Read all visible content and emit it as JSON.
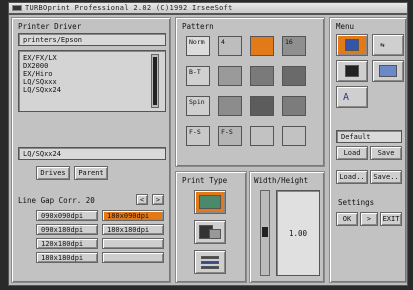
{
  "window": {
    "title": "TURBOprint Professional 2.02 (C)1992 IrseeSoft"
  },
  "printer_driver": {
    "heading": "Printer Driver",
    "path_value": "printers/Epson",
    "list_items": [
      "EX/FX/LX",
      "DX2000",
      "EX/Hiro",
      "LQ/SQxxx",
      "LQ/SQxx24"
    ],
    "selected_value": "LQ/SQxx24",
    "drives_button": "Drives",
    "parent_button": "Parent"
  },
  "line_gap": {
    "label": "Line Gap Corr. 20",
    "dec_button": "<",
    "inc_button": ">",
    "resolutions": [
      {
        "label": "090x090dpi",
        "selected": false
      },
      {
        "label": "180x090dpi",
        "selected": true
      },
      {
        "label": "090x180dpi",
        "selected": false
      },
      {
        "label": "180x180dpi",
        "selected": false
      },
      {
        "label": "120x180dpi",
        "selected": false
      },
      {
        "label": "",
        "selected": false
      },
      {
        "label": "180x180dpi",
        "selected": false
      },
      {
        "label": "",
        "selected": false
      }
    ]
  },
  "pattern": {
    "heading": "Pattern",
    "tiles": [
      {
        "label": "Norm",
        "selected": false
      },
      {
        "label": "4",
        "selected": false
      },
      {
        "label": "",
        "selected": true
      },
      {
        "label": "16",
        "selected": false
      },
      {
        "label": "B-T",
        "selected": false
      },
      {
        "label": "",
        "selected": false
      },
      {
        "label": "",
        "selected": false
      },
      {
        "label": "",
        "selected": false
      },
      {
        "label": "Spin",
        "selected": false
      },
      {
        "label": "",
        "selected": false
      },
      {
        "label": "",
        "selected": false
      },
      {
        "label": "",
        "selected": false
      },
      {
        "label": "F-S",
        "selected": false
      },
      {
        "label": "F-S",
        "selected": false
      },
      {
        "label": "",
        "selected": false
      },
      {
        "label": "",
        "selected": false
      }
    ]
  },
  "print_type": {
    "heading": "Print Type"
  },
  "width_height": {
    "heading": "Width/Height",
    "ratio_value": "1.00"
  },
  "menu": {
    "heading": "Menu",
    "preset_value": "Default",
    "load_button": "Load",
    "save_button": "Save",
    "load_as_button": "Load..",
    "save_as_button": "Save..",
    "settings_heading": "Settings",
    "ok_button": "OK",
    "mid_button": ">",
    "exit_button": "EXIT"
  },
  "colors": {
    "selected": "#e37a1a",
    "panel": "#c2c2c2"
  }
}
